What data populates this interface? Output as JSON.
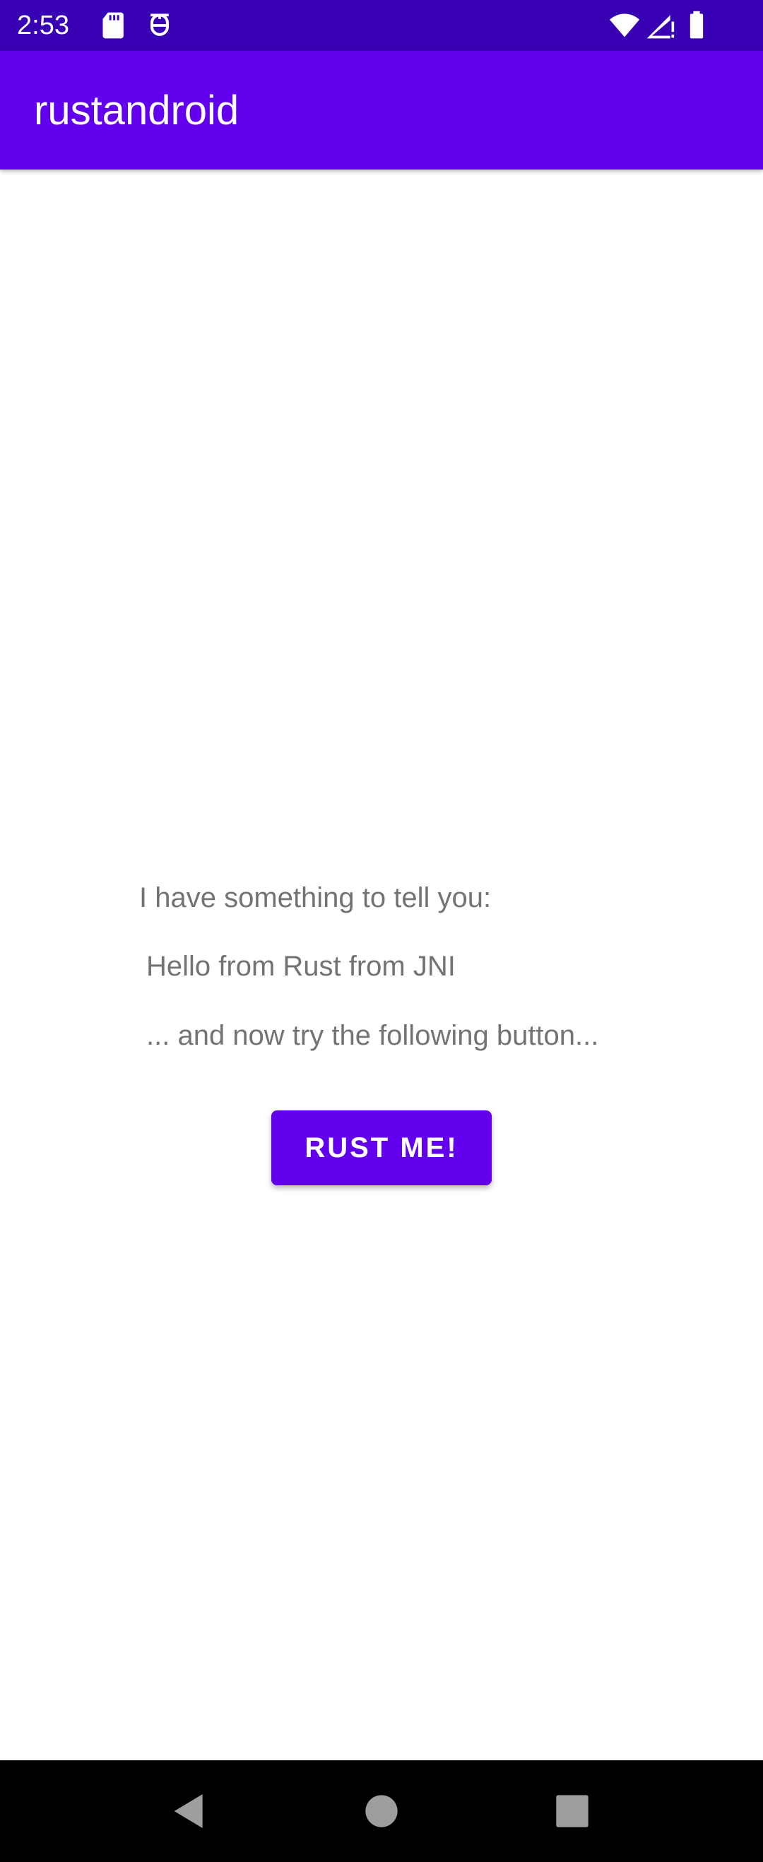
{
  "status_bar": {
    "time": "2:53",
    "background": "#3700b3",
    "icons": [
      "sd-card-icon",
      "debug-icon",
      "wifi-icon",
      "cell-signal-icon",
      "battery-icon"
    ]
  },
  "app_bar": {
    "title": "rustandroid",
    "background": "#6200ee"
  },
  "main": {
    "intro_text": "I have something to tell you:",
    "message_text": "Hello from Rust from JNI",
    "prompt_text": "... and now try the following button...",
    "button_label": "RUST ME!"
  },
  "colors": {
    "primary": "#6200ee",
    "primary_dark": "#3700b3",
    "text_secondary": "#737373"
  },
  "nav_bar": {
    "icons": [
      "back-icon",
      "home-icon",
      "recents-icon"
    ]
  }
}
